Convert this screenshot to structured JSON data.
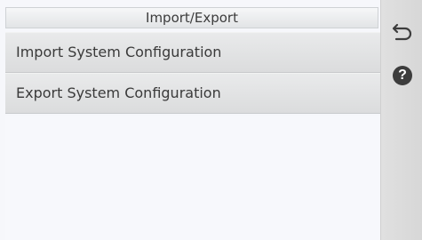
{
  "header": {
    "title": "Import/Export"
  },
  "menu": {
    "items": [
      {
        "label": "Import System Configuration"
      },
      {
        "label": "Export System Configuration"
      }
    ]
  },
  "sidebar": {
    "buttons": [
      {
        "icon": "back-arrow-icon"
      },
      {
        "icon": "help-icon",
        "glyph": "?"
      }
    ]
  },
  "colors": {
    "panel_background": "#f6f7fb",
    "menu_item_background": "#e0e1e2",
    "sidebar_background": "#dcdcdc",
    "help_icon_fill": "#3d3d3d"
  }
}
